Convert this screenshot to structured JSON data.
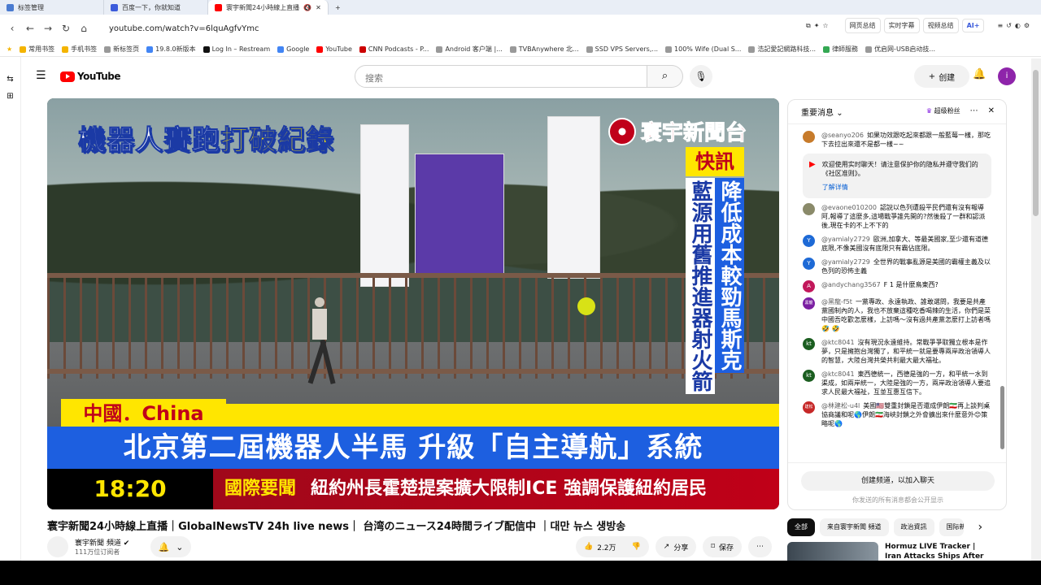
{
  "browser": {
    "tabs": [
      {
        "label": "标签管理",
        "color": "#4a7bd0"
      },
      {
        "label": "百度一下，你就知道",
        "color": "#3b5bdb"
      },
      {
        "label": "寰宇新聞24小時線上直播",
        "color": "#ff0000",
        "active": true
      }
    ],
    "new_tab": "+",
    "url": "youtube.com/watch?v=6lquAgfvYmc",
    "extensions": [
      "网页总结",
      "实时字幕",
      "视频总结",
      "AI+"
    ],
    "bookmarks": [
      {
        "label": "常用书签",
        "color": "#f4b400"
      },
      {
        "label": "手机书签",
        "color": "#f4b400"
      },
      {
        "label": "新标签页",
        "color": "#999999"
      },
      {
        "label": "19.8.0新版本",
        "color": "#4285f4"
      },
      {
        "label": "Log In – Restream",
        "color": "#111111"
      },
      {
        "label": "Google",
        "color": "#4285f4"
      },
      {
        "label": "YouTube",
        "color": "#ff0000"
      },
      {
        "label": "CNN Podcasts - P...",
        "color": "#cc0000"
      },
      {
        "label": "Android 客户端 |...",
        "color": "#999999"
      },
      {
        "label": "TVBAnywhere 北...",
        "color": "#999999"
      },
      {
        "label": "SSD VPS Servers,...",
        "color": "#999999"
      },
      {
        "label": "100% Wife (Dual S...",
        "color": "#999999"
      },
      {
        "label": "浩記愛記網路科技...",
        "color": "#999999"
      },
      {
        "label": "律師服務",
        "color": "#34a853"
      },
      {
        "label": "优启网-USB启动技...",
        "color": "#999999"
      }
    ]
  },
  "youtube": {
    "logo_text": "YouTube",
    "search_placeholder": "搜索",
    "create_label": "创建",
    "avatar_letter": "i"
  },
  "video": {
    "headline_top_white": "機器人賽跑",
    "headline_top_yellow": "打破紀錄",
    "station": "寰宇新聞台",
    "flash": "快訊",
    "vertical_left": "藍源用舊推進器射火箭",
    "vertical_right": "降低成本較勁馬斯克",
    "location": "中國．China",
    "main_headline": "北京第二屆機器人半馬 升級「自主導航」系統",
    "time": "18:20",
    "ticker_tag": "國際要聞",
    "ticker_text": "紐約州長霍楚提案擴大限制ICE 強調保護紐約居民"
  },
  "title": "寰宇新聞24小時線上直播｜GlobalNewsTV 24h live news｜ 台湾のニュース24時間ライブ配信中 ｜대만 뉴스 생방송",
  "channel": {
    "name": "寰宇新聞 頻道",
    "subscribers": "111万位订阅者"
  },
  "actions": {
    "like_count": "2.2万",
    "share": "分享",
    "save": "保存"
  },
  "chat": {
    "header": "重要消息",
    "super_fan": "超级粉丝",
    "messages": [
      {
        "user": "@seanyo206",
        "text": "如果功效跟吃起來都跟一般藍莓一樣，那吃下去拉出來還不是都一樣~~",
        "color": "#c77b2b",
        "avatar": ""
      },
      {
        "user": "@evaone010200",
        "text": "認說以色列遭殺平民們還有沒有報導阿,報導了這麼多,這場戰爭誰先開的?然後殺了一群和認派後,現在卡的不上不下的",
        "color": "#8a8a6a",
        "avatar": ""
      },
      {
        "user": "@yamialy2729",
        "text": "歐洲,加拿大、等最美國家,至少還有道德底限,不像美國沒有底限只有霸佔底限。",
        "color": "#1e6ad6",
        "avatar": "Y"
      },
      {
        "user": "@yamialy2729",
        "text": "全世界的戰事亂源是美國的霸權主義及以色列的恐怖主義",
        "color": "#1e6ad6",
        "avatar": "Y"
      },
      {
        "user": "@andychang3567",
        "text": "F 1 是什麼鳥東西?",
        "color": "#c2185b",
        "avatar": "A"
      },
      {
        "user": "@黑龍-f5t",
        "text": "一黨專政、永遠執政、誰敢選問，我要是共產黨國制內的人，我也不放棄這種吃香喝辣的生活，你們是菜中國吾吃歡怎麼樣，上訪嗎～沒有過共產黨怎麼打上訪者嗎 🤣 🤣",
        "color": "#7b1fa2",
        "avatar": "黑龍"
      },
      {
        "user": "@ktc8041",
        "text": "沒有現況永遠維持。常戰爭爭取獨立根本是作夢，只是擁抱台灣獨了，和平統一就是要專兩岸政治領導人的智慧，大陸台灣共榮共利最大最大福祉。",
        "color": "#1b5e20",
        "avatar": "kt"
      },
      {
        "user": "@ktc8041",
        "text": "東西德統一，西德是強的一方，和平統一水到渠成，如兩岸統一，大陸是強的一方，兩岸政治領導人要追求人民最大福祉，互並互惠互信下。",
        "color": "#1b5e20",
        "avatar": "kt"
      },
      {
        "user": "@林建松-u4l",
        "text": "美國🇺🇸雙重封鎖是否還成伊朗🇮🇷再上談判桌協商議和呢🌎伊朗🇮🇷海峽封鎖之外會擴出來什麼意外😊策略呢🌎",
        "color": "#c62828",
        "avatar": "建松"
      }
    ],
    "notice_text": "欢迎使用实时聊天！请注意保护你的隐私并遵守我们的《社区准则》。",
    "notice_link": "了解详情",
    "join_label": "创建频道，以加入聊天",
    "footer_note": "你发送的所有消息都会公开显示"
  },
  "chips": [
    "全部",
    "来自寰宇新聞 頻道",
    "政治資訊",
    "国际新"
  ],
  "recommendation": {
    "title": "Hormuz LIVE Tracker | Iran Attacks Ships After Strait..."
  }
}
